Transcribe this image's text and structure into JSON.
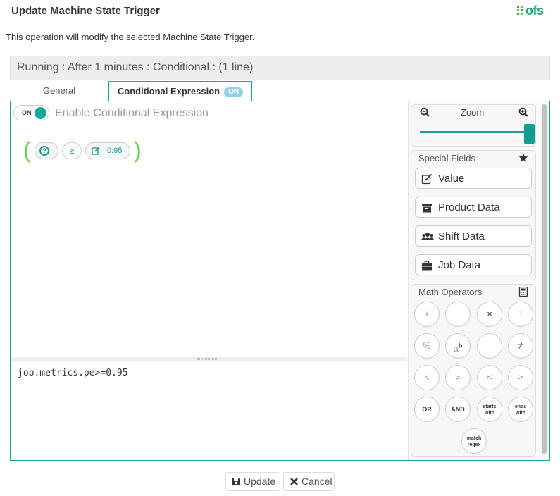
{
  "header": {
    "title": "Update Machine State Trigger",
    "logo_text": "ofs"
  },
  "subtitle": "This operation will modify the selected Machine State Trigger.",
  "summary": "Running : After 1 minutes : Conditional : (1 line)",
  "tabs": [
    {
      "label": "General",
      "active": false
    },
    {
      "label": "Conditional Expression",
      "badge": "ON",
      "active": true
    }
  ],
  "toggle": {
    "state_label": "ON",
    "label": "Enable Conditional Expression",
    "on": true
  },
  "expression": {
    "field_icon": "question-circle-icon",
    "operator": "≥",
    "value": "0.95",
    "code": "job.metrics.pe>=0.95"
  },
  "zoom": {
    "label": "Zoom",
    "level": 1.0
  },
  "special_fields": {
    "title": "Special Fields",
    "items": [
      {
        "label": "Value",
        "icon": "edit-icon"
      },
      {
        "label": "Product Data",
        "icon": "archive-icon"
      },
      {
        "label": "Shift Data",
        "icon": "users-icon"
      },
      {
        "label": "Job Data",
        "icon": "briefcase-icon"
      }
    ]
  },
  "math_operators": {
    "title": "Math Operators",
    "ops": [
      {
        "label": "+"
      },
      {
        "label": "−"
      },
      {
        "label": "×"
      },
      {
        "label": "÷"
      },
      {
        "label": "%"
      },
      {
        "label": "ab"
      },
      {
        "label": "="
      },
      {
        "label": "≠"
      },
      {
        "label": "<"
      },
      {
        "label": ">"
      },
      {
        "label": "≤"
      },
      {
        "label": "≥"
      },
      {
        "label": "OR"
      },
      {
        "label": "AND"
      },
      {
        "label": "starts with"
      },
      {
        "label": "ends with"
      },
      {
        "label": "match regex"
      }
    ]
  },
  "footer": {
    "update_label": "Update",
    "cancel_label": "Cancel"
  },
  "colors": {
    "accent": "#19a59b",
    "paren": "#6ccf4a",
    "badge": "#8fd0ea"
  }
}
